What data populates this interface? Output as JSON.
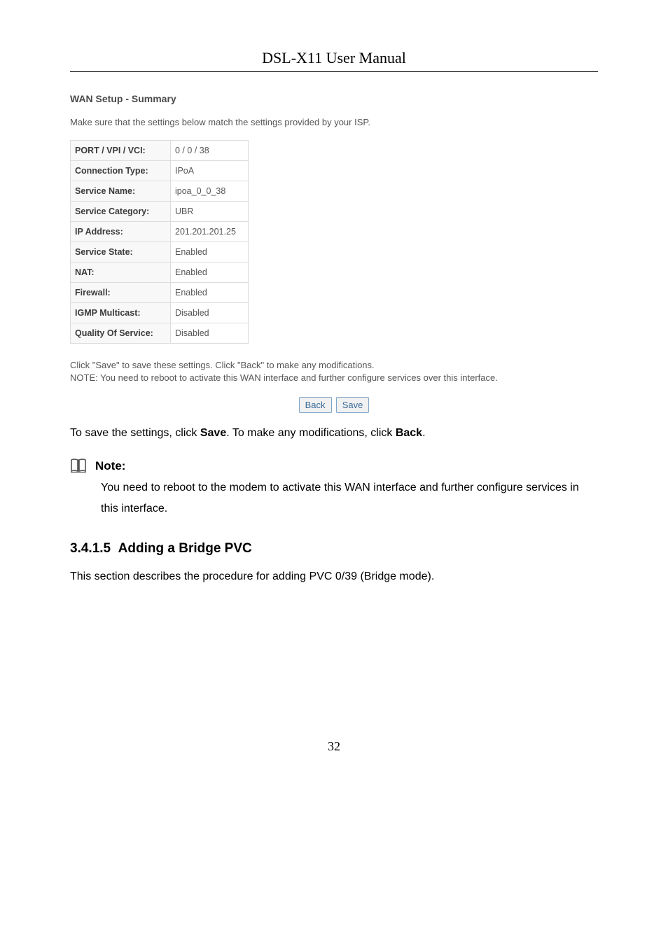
{
  "doc_title": "DSL-X11 User Manual",
  "panel": {
    "title": "WAN Setup - Summary",
    "desc": "Make sure that the settings below match the settings provided by your ISP.",
    "rows": [
      {
        "label": "PORT / VPI / VCI:",
        "value": "0 / 0 / 38"
      },
      {
        "label": "Connection Type:",
        "value": "IPoA"
      },
      {
        "label": "Service Name:",
        "value": "ipoa_0_0_38"
      },
      {
        "label": "Service Category:",
        "value": "UBR"
      },
      {
        "label": "IP Address:",
        "value": "201.201.201.25"
      },
      {
        "label": "Service State:",
        "value": "Enabled"
      },
      {
        "label": "NAT:",
        "value": "Enabled"
      },
      {
        "label": "Firewall:",
        "value": "Enabled"
      },
      {
        "label": "IGMP Multicast:",
        "value": "Disabled"
      },
      {
        "label": "Quality Of Service:",
        "value": "Disabled"
      }
    ],
    "post1": "Click \"Save\" to save these settings. Click \"Back\" to make any modifications.",
    "post2": "NOTE: You need to reboot to activate this WAN interface and further configure services over this interface.",
    "back": "Back",
    "save": "Save"
  },
  "body1_a": "To save the settings, click ",
  "body1_b": "Save",
  "body1_c": ". To make any modifications, click ",
  "body1_d": "Back",
  "body1_e": ".",
  "note": {
    "label": "Note:",
    "body": "You need to reboot to the modem to activate this WAN interface and further configure services in this interface."
  },
  "section_num": "3.4.1.5",
  "section_title": "Adding a Bridge PVC",
  "section_body": "This section describes the procedure for adding PVC 0/39 (Bridge mode).",
  "page_num": "32"
}
